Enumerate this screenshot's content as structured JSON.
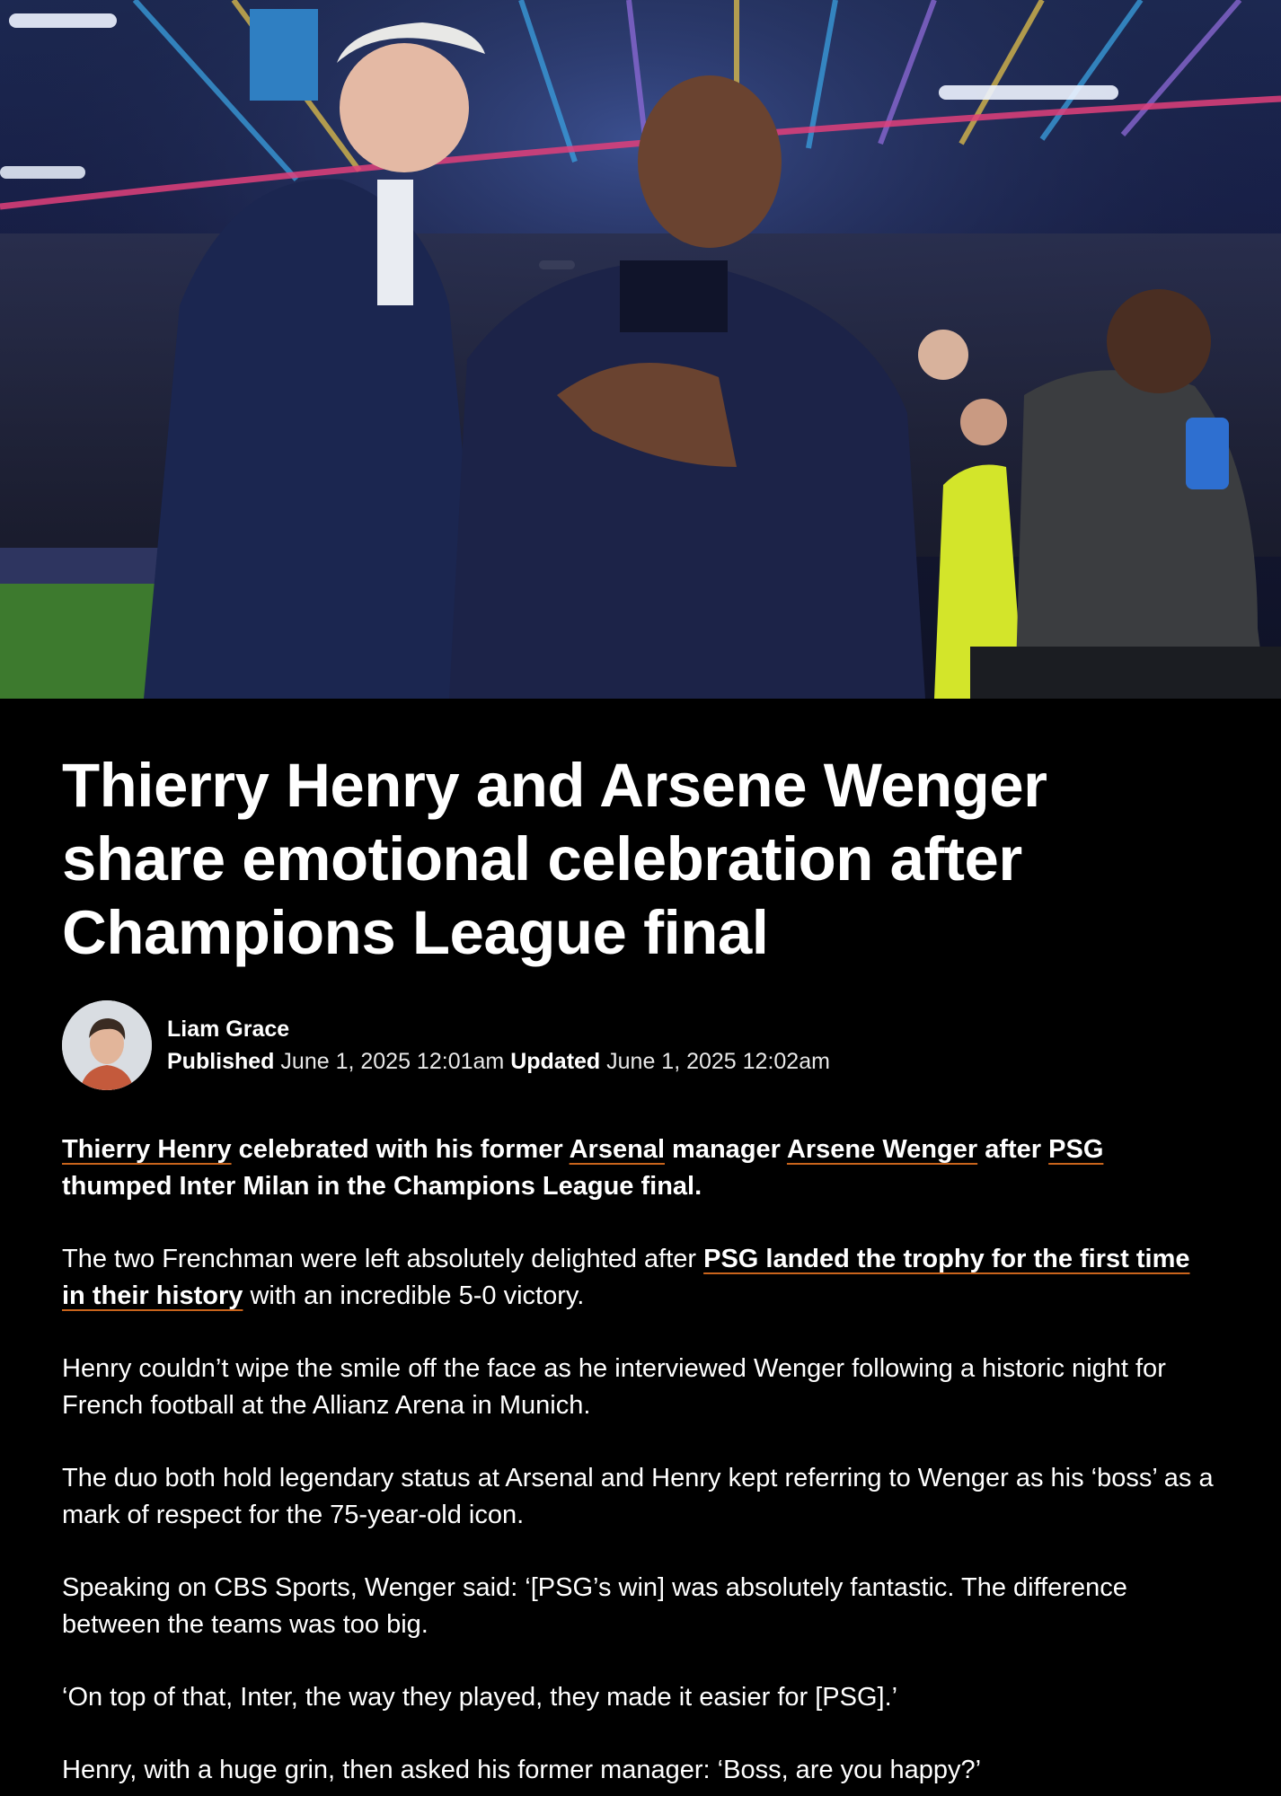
{
  "article": {
    "headline": "Thierry Henry and Arsene Wenger share emotional celebration after Champions League final",
    "author": "Liam Grace",
    "published_label": "Published",
    "published_value": "June 1, 2025 12:01am",
    "updated_label": "Updated",
    "updated_value": "June 1, 2025 12:02am",
    "lead": {
      "link_henry": "Thierry Henry",
      "t1": " celebrated with his former ",
      "link_arsenal": "Arsenal",
      "t2": " manager ",
      "link_wenger": "Arsene Wenger",
      "t3": " after ",
      "link_psg": "PSG",
      "t4": " thumped Inter Milan in the Champions League final."
    },
    "p2": {
      "t1": "The two Frenchman were left absolutely delighted after ",
      "link": "PSG landed the trophy for the first time in their history",
      "t2": " with an incredible 5-0 victory."
    },
    "p3": "Henry couldn’t wipe the smile off the face as he interviewed Wenger following a historic night for French football at the Allianz Arena in Munich.",
    "p4": "The duo both hold legendary status at Arsenal and Henry kept referring to Wenger as his ‘boss’ as a mark of respect for the 75-year-old icon.",
    "p5": "Speaking on CBS Sports, Wenger said: ‘[PSG’s win] was absolutely fantastic. The difference between the teams was too big.",
    "p6": "‘On top of that, Inter, the way they played, they made it easier for [PSG].’",
    "p7": "Henry, with a huge grin, then asked his former manager: ‘Boss, are you happy?’"
  },
  "colors": {
    "background": "#000000",
    "text": "#ffffff",
    "link_underline": "#c9641c"
  }
}
